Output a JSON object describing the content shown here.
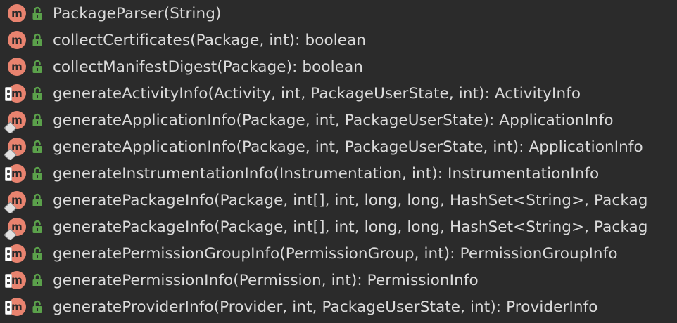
{
  "colors": {
    "background": "#2b2b2b",
    "method_icon": "#e8836f",
    "public_lock": "#5ba14b",
    "text": "#dadada"
  },
  "items": [
    {
      "label": "PackageParser(String)",
      "icon": "method-icon",
      "badge": "none"
    },
    {
      "label": "collectCertificates(Package, int): boolean",
      "icon": "method-icon",
      "badge": "none"
    },
    {
      "label": "collectManifestDigest(Package): boolean",
      "icon": "method-icon",
      "badge": "none"
    },
    {
      "label": "generateActivityInfo(Activity, int, PackageUserState, int): ActivityInfo",
      "icon": "method-icon",
      "badge": "static"
    },
    {
      "label": "generateApplicationInfo(Package, int, PackageUserState): ApplicationInfo",
      "icon": "method-icon",
      "badge": "override"
    },
    {
      "label": "generateApplicationInfo(Package, int, PackageUserState, int): ApplicationInfo",
      "icon": "method-icon",
      "badge": "override"
    },
    {
      "label": "generateInstrumentationInfo(Instrumentation, int): InstrumentationInfo",
      "icon": "method-icon",
      "badge": "static"
    },
    {
      "label": "generatePackageInfo(Package, int[], int, long, long, HashSet<String>, Packag",
      "icon": "method-icon",
      "badge": "override"
    },
    {
      "label": "generatePackageInfo(Package, int[], int, long, long, HashSet<String>, Packag",
      "icon": "method-icon",
      "badge": "override"
    },
    {
      "label": "generatePermissionGroupInfo(PermissionGroup, int): PermissionGroupInfo",
      "icon": "method-icon",
      "badge": "static"
    },
    {
      "label": "generatePermissionInfo(Permission, int): PermissionInfo",
      "icon": "method-icon",
      "badge": "static"
    },
    {
      "label": "generateProviderInfo(Provider, int, PackageUserState, int): ProviderInfo",
      "icon": "method-icon",
      "badge": "static"
    }
  ],
  "icon_glyph": "m"
}
